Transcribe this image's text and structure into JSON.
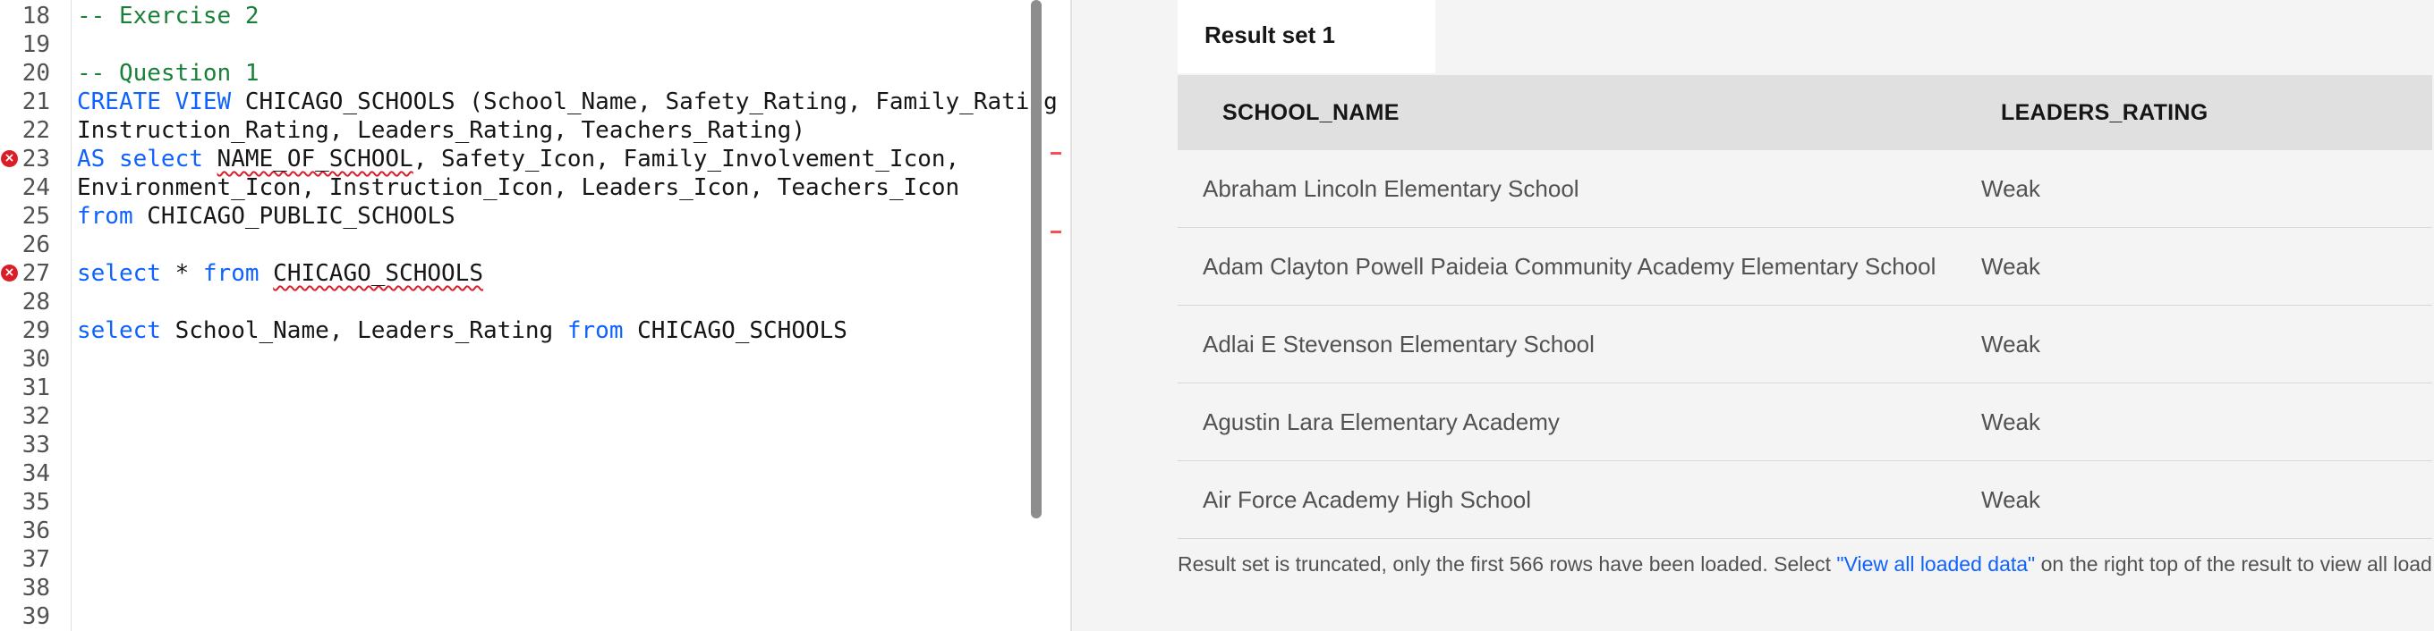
{
  "editor": {
    "lines": [
      {
        "number": "18",
        "error": false,
        "tokens": [
          {
            "t": "-- Exercise 2",
            "c": "comment"
          }
        ]
      },
      {
        "number": "19",
        "error": false,
        "tokens": []
      },
      {
        "number": "20",
        "error": false,
        "tokens": [
          {
            "t": "-- Question 1",
            "c": "comment"
          }
        ]
      },
      {
        "number": "21",
        "error": false,
        "tokens": [
          {
            "t": "CREATE VIEW",
            "c": "keyword"
          },
          {
            "t": " CHICAGO_SCHOOLS (School_Name, Safety_Rating, Family_Rating",
            "c": "plain"
          }
        ]
      },
      {
        "number": "22",
        "error": false,
        "tokens": [
          {
            "t": "Instruction_Rating, Leaders_Rating, Teachers_Rating)",
            "c": "plain"
          }
        ]
      },
      {
        "number": "23",
        "error": true,
        "tokens": [
          {
            "t": "AS select",
            "c": "keyword"
          },
          {
            "t": " ",
            "c": "plain"
          },
          {
            "t": "NAME_OF_SCHOOL",
            "c": "squiggle"
          },
          {
            "t": ", Safety_Icon, Family_Involvement_Icon,",
            "c": "plain"
          }
        ]
      },
      {
        "number": "24",
        "error": false,
        "tokens": [
          {
            "t": "Environment_Icon, Instruction_Icon, Leaders_Icon, Teachers_Icon",
            "c": "plain"
          }
        ]
      },
      {
        "number": "25",
        "error": false,
        "tokens": [
          {
            "t": "from",
            "c": "keyword"
          },
          {
            "t": " CHICAGO_PUBLIC_SCHOOLS",
            "c": "plain"
          }
        ]
      },
      {
        "number": "26",
        "error": false,
        "tokens": []
      },
      {
        "number": "27",
        "error": true,
        "tokens": [
          {
            "t": "select",
            "c": "keyword"
          },
          {
            "t": " * ",
            "c": "plain"
          },
          {
            "t": "from",
            "c": "keyword"
          },
          {
            "t": " ",
            "c": "plain"
          },
          {
            "t": "CHICAGO_SCHOOLS",
            "c": "squiggle"
          }
        ]
      },
      {
        "number": "28",
        "error": false,
        "tokens": []
      },
      {
        "number": "29",
        "error": false,
        "tokens": [
          {
            "t": "select",
            "c": "keyword"
          },
          {
            "t": " School_Name, Leaders_Rating ",
            "c": "plain"
          },
          {
            "t": "from",
            "c": "keyword"
          },
          {
            "t": " CHICAGO_SCHOOLS",
            "c": "plain"
          }
        ]
      },
      {
        "number": "30",
        "error": false,
        "tokens": []
      },
      {
        "number": "31",
        "error": false,
        "tokens": []
      },
      {
        "number": "32",
        "error": false,
        "tokens": []
      },
      {
        "number": "33",
        "error": false,
        "tokens": []
      },
      {
        "number": "34",
        "error": false,
        "tokens": []
      },
      {
        "number": "35",
        "error": false,
        "tokens": []
      },
      {
        "number": "36",
        "error": false,
        "tokens": []
      },
      {
        "number": "37",
        "error": false,
        "tokens": []
      },
      {
        "number": "38",
        "error": false,
        "tokens": []
      },
      {
        "number": "39",
        "error": false,
        "tokens": []
      }
    ],
    "error_icon": "error-circle-icon"
  },
  "results": {
    "tab_label": "Result set 1",
    "columns": [
      "SCHOOL_NAME",
      "LEADERS_RATING"
    ],
    "rows": [
      [
        "Abraham Lincoln Elementary School",
        "Weak"
      ],
      [
        "Adam Clayton Powell Paideia Community Academy Elementary School",
        "Weak"
      ],
      [
        "Adlai E Stevenson Elementary School",
        "Weak"
      ],
      [
        "Agustin Lara Elementary Academy",
        "Weak"
      ],
      [
        "Air Force Academy High School",
        "Weak"
      ]
    ],
    "footer_prefix": "Result set is truncated, only the first 566 rows have been loaded. Select ",
    "footer_link": "\"View all loaded data\"",
    "footer_suffix": " on the right top of the result to view all loaded ro"
  },
  "colors": {
    "keyword": "#0f62fe",
    "comment": "#198038",
    "error": "#da1e28",
    "link": "#0f62fe"
  }
}
